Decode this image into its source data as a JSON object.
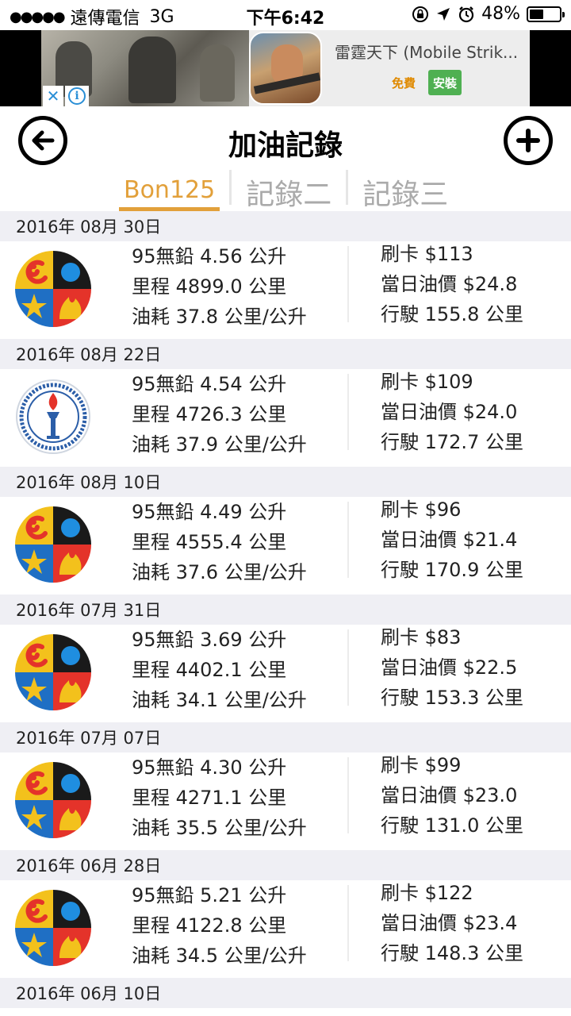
{
  "status_bar": {
    "carrier": "遠傳電信",
    "network": "3G",
    "time": "下午6:42",
    "battery": "48%",
    "battery_level": 0.48
  },
  "ad": {
    "title": "雷霆天下 (Mobile Strik...",
    "free_label": "免費",
    "install_label": "安裝",
    "close_symbol": "✕",
    "info_symbol": "i"
  },
  "header": {
    "title": "加油記錄",
    "back_icon": "arrow-left-circle-icon",
    "add_icon": "plus-circle-icon"
  },
  "tabs": [
    {
      "label": "Bon125",
      "active": true
    },
    {
      "label": "記錄二",
      "active": false
    },
    {
      "label": "記錄三",
      "active": false
    }
  ],
  "colors": {
    "accent": "#e2a03a",
    "date_bg": "#efeff4",
    "install_green": "#4fb052"
  },
  "records": [
    {
      "date": "2016年 08月 30日",
      "station": "formosa",
      "fuel": "95無鉛 4.56 公升",
      "mileage": "里程 4899.0 公里",
      "consumption": "油耗 37.8 公里/公升",
      "payment": "刷卡 $113",
      "price": "當日油價 $24.8",
      "distance": "行駛 155.8 公里"
    },
    {
      "date": "2016年 08月 22日",
      "station": "cpc",
      "fuel": "95無鉛 4.54 公升",
      "mileage": "里程 4726.3 公里",
      "consumption": "油耗 37.9 公里/公升",
      "payment": "刷卡 $109",
      "price": "當日油價 $24.0",
      "distance": "行駛 172.7 公里"
    },
    {
      "date": "2016年 08月 10日",
      "station": "formosa",
      "fuel": "95無鉛 4.49 公升",
      "mileage": "里程 4555.4 公里",
      "consumption": "油耗 37.6 公里/公升",
      "payment": "刷卡 $96",
      "price": "當日油價 $21.4",
      "distance": "行駛 170.9 公里"
    },
    {
      "date": "2016年 07月 31日",
      "station": "formosa",
      "fuel": "95無鉛 3.69 公升",
      "mileage": "里程 4402.1 公里",
      "consumption": "油耗 34.1 公里/公升",
      "payment": "刷卡 $83",
      "price": "當日油價 $22.5",
      "distance": "行駛 153.3 公里"
    },
    {
      "date": "2016年 07月 07日",
      "station": "formosa",
      "fuel": "95無鉛 4.30 公升",
      "mileage": "里程 4271.1 公里",
      "consumption": "油耗 35.5 公里/公升",
      "payment": "刷卡 $99",
      "price": "當日油價 $23.0",
      "distance": "行駛 131.0 公里"
    },
    {
      "date": "2016年 06月 28日",
      "station": "formosa",
      "fuel": "95無鉛 5.21 公升",
      "mileage": "里程 4122.8 公里",
      "consumption": "油耗 34.5 公里/公升",
      "payment": "刷卡 $122",
      "price": "當日油價 $23.4",
      "distance": "行駛 148.3 公里"
    },
    {
      "date": "2016年 06月 10日"
    }
  ]
}
